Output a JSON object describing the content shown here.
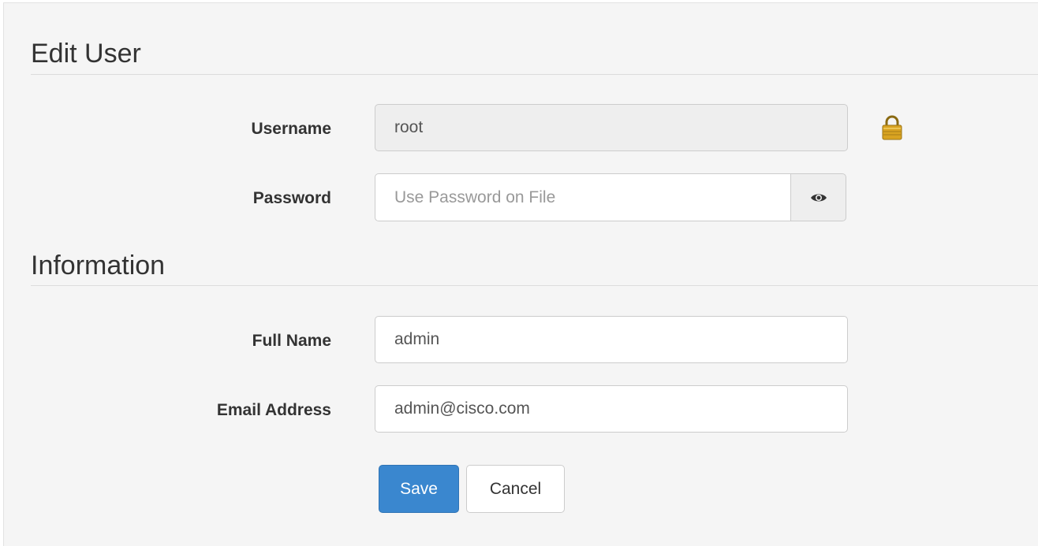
{
  "colors": {
    "panel_background": "#f5f5f5",
    "primary_button": "#3a87cf",
    "readonly_input": "#eeeeee",
    "lock_icon": "#d9a321"
  },
  "edit_user": {
    "title": "Edit User",
    "username": {
      "label": "Username",
      "value": "root",
      "icon": "lock-icon"
    },
    "password": {
      "label": "Password",
      "value": "",
      "placeholder": "Use Password on File",
      "toggle_icon": "eye-icon"
    }
  },
  "information": {
    "title": "Information",
    "full_name": {
      "label": "Full Name",
      "value": "admin"
    },
    "email": {
      "label": "Email Address",
      "value": "admin@cisco.com"
    }
  },
  "actions": {
    "save_label": "Save",
    "cancel_label": "Cancel"
  }
}
